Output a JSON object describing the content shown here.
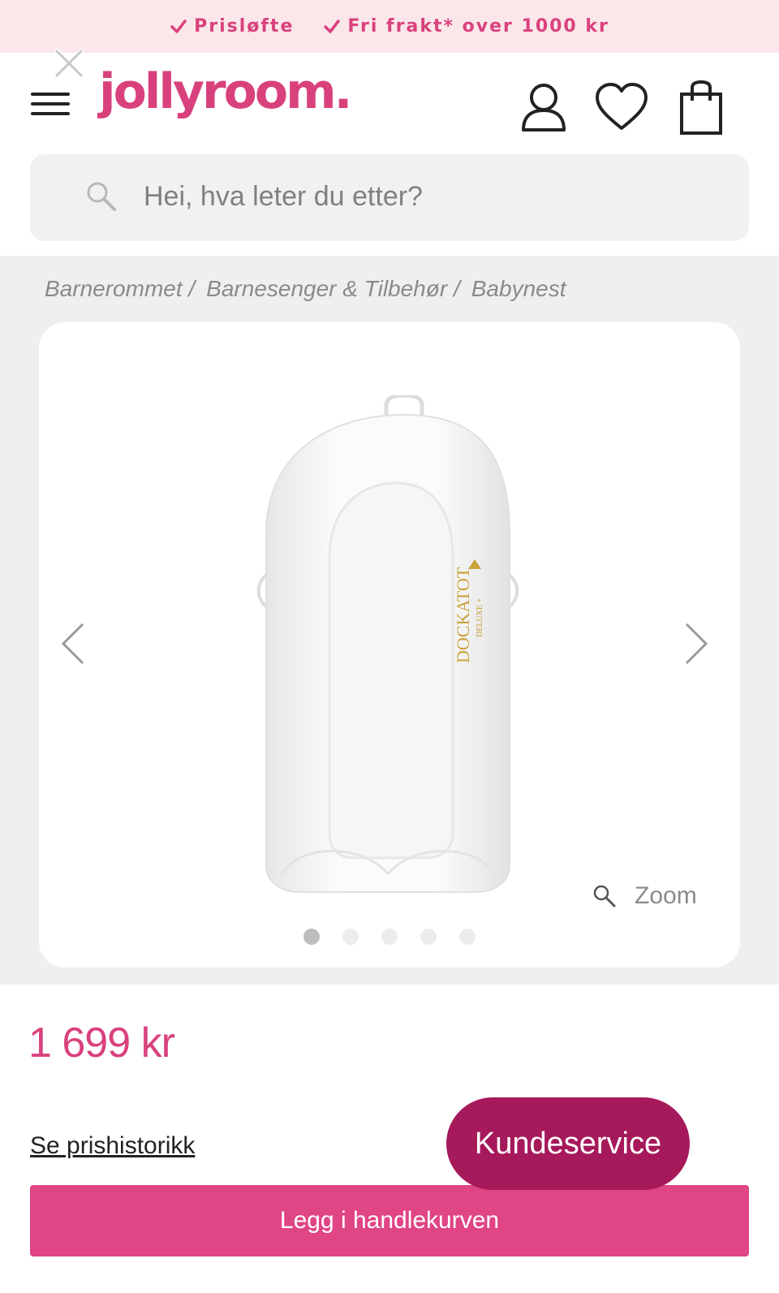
{
  "promo": {
    "items": [
      {
        "label": "Prisløfte"
      },
      {
        "label": "Fri frakt* over 1000 kr"
      }
    ],
    "accent_color": "#d9417d",
    "background": "#fbe7ea"
  },
  "header": {
    "logo_text": "jollyroom.",
    "icons": [
      "close-icon",
      "hamburger-menu-icon",
      "user-icon",
      "heart-icon",
      "shopping-bag-icon"
    ]
  },
  "search": {
    "placeholder": "Hei, hva leter du etter?"
  },
  "breadcrumb": [
    {
      "label": "Barnerommet /"
    },
    {
      "label": "Barnesenger & Tilbehør /"
    },
    {
      "label": "Babynest"
    }
  ],
  "gallery": {
    "image_brand_text": "DOCKATOT",
    "image_sub_text": "DELUXE +",
    "zoom_label": "Zoom",
    "dot_count": 5,
    "active_dot": 0
  },
  "product": {
    "price": "1 699 kr",
    "price_history_link": "Se prishistorikk",
    "customer_service_button": "Kundeservice",
    "add_to_cart_button": "Legg i handlekurven"
  },
  "colors": {
    "brand_pink": "#d9417d",
    "customer_service_bg": "#a6195b",
    "add_to_cart_bg": "#e04585",
    "section_gray": "#efefef"
  }
}
